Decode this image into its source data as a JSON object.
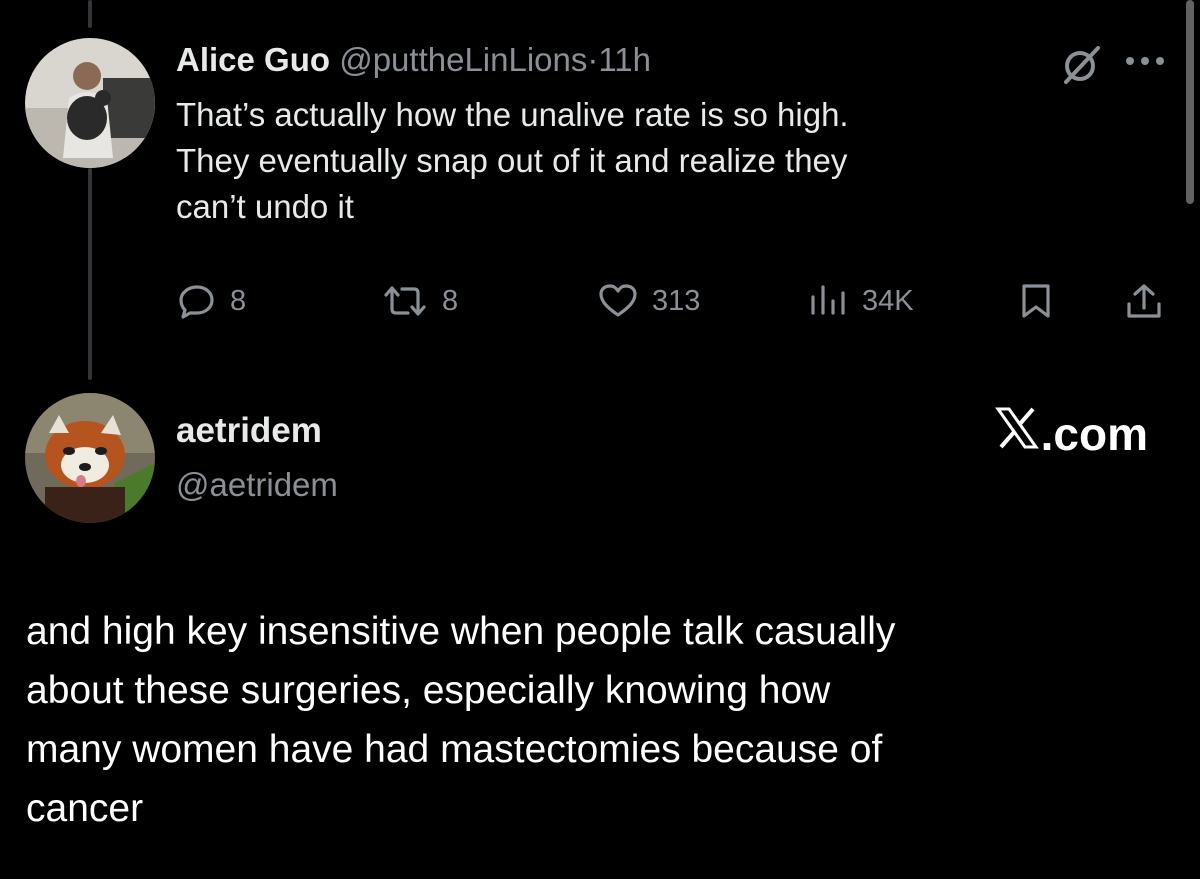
{
  "original_tweet": {
    "author_name": "Alice Guo",
    "handle": "@puttheLinLions",
    "separator": "·",
    "time": "11h",
    "text_lines": [
      "That’s actually how the unalive rate is so high.",
      "They eventually snap out of it and realize they",
      "can’t undo it"
    ],
    "actions": {
      "replies": "8",
      "reposts": "8",
      "likes": "313",
      "views": "34K"
    },
    "icons": [
      "grok-icon",
      "more-icon",
      "reply-icon",
      "repost-icon",
      "like-icon",
      "views-icon",
      "bookmark-icon",
      "share-icon"
    ]
  },
  "reply_tweet": {
    "author_name": "aetridem",
    "handle": "@aetridem",
    "brand": "X.com",
    "brand_suffix": ".com",
    "text_lines": [
      "and high key insensitive when people talk casually",
      "about these surgeries, especially knowing how",
      "many women have had mastectomies because of",
      "cancer"
    ]
  },
  "colors": {
    "background": "#000000",
    "text": "#e7e9ea",
    "muted": "#8b9096",
    "thread_line": "#333639"
  }
}
